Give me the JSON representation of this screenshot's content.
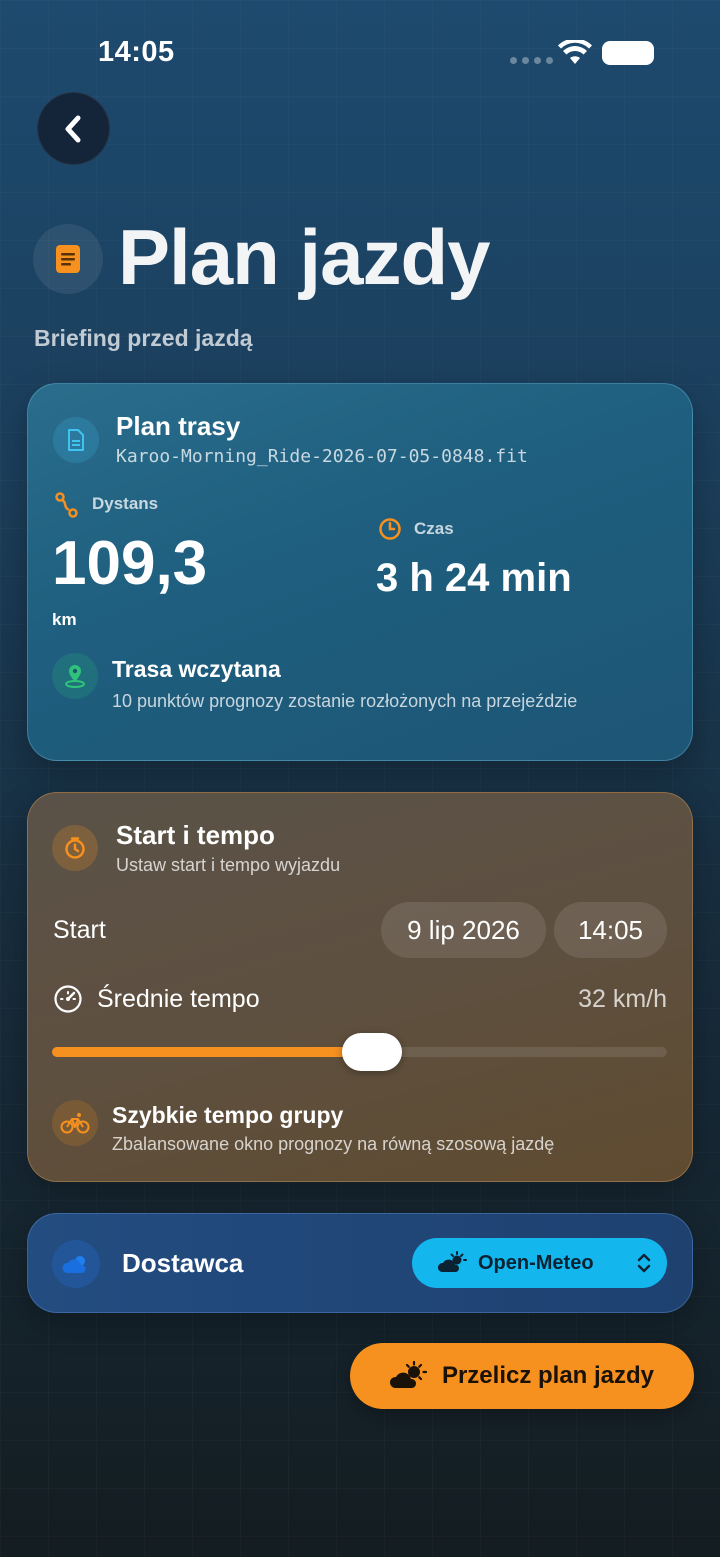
{
  "status_bar": {
    "time": "14:05"
  },
  "header": {
    "title": "Plan jazdy",
    "subtitle": "Briefing przed jazdą"
  },
  "route_card": {
    "title": "Plan trasy",
    "file_name": "Karoo-Morning_Ride-2026-07-05-0848.fit",
    "distance_label": "Dystans",
    "distance_value": "109,3",
    "distance_unit": "km",
    "time_label": "Czas",
    "time_value": "3 h 24 min",
    "loaded_title": "Trasa wczytana",
    "loaded_description": "10 punktów prognozy zostanie rozłożonych na przejeździe"
  },
  "start_card": {
    "title": "Start i tempo",
    "subtitle": "Ustaw start i tempo wyjazdu",
    "start_label": "Start",
    "start_date": "9 lip 2026",
    "start_time": "14:05",
    "pace_label": "Średnie tempo",
    "pace_value": "32 km/h",
    "pace_slider_fraction": 0.52,
    "preset_title": "Szybkie tempo grupy",
    "preset_description": "Zbalansowane okno prognozy na równą szosową jazdę"
  },
  "provider_card": {
    "label": "Dostawca",
    "selected": "Open-Meteo"
  },
  "cta": {
    "label": "Przelicz plan jazdy"
  },
  "colors": {
    "accent_orange": "#f6901e",
    "accent_cyan": "#13b7ee",
    "success_green": "#2fc27a"
  },
  "icons": {
    "back": "chevron-left-icon",
    "title": "document-list-icon",
    "route_file": "document-icon",
    "distance": "route-icon",
    "time": "clock-icon",
    "loaded": "map-pin-icon",
    "start": "timer-icon",
    "pace": "speedometer-icon",
    "preset": "bicycle-icon",
    "provider": "cloud-sun-icon",
    "select": "chevron-up-down-icon"
  }
}
